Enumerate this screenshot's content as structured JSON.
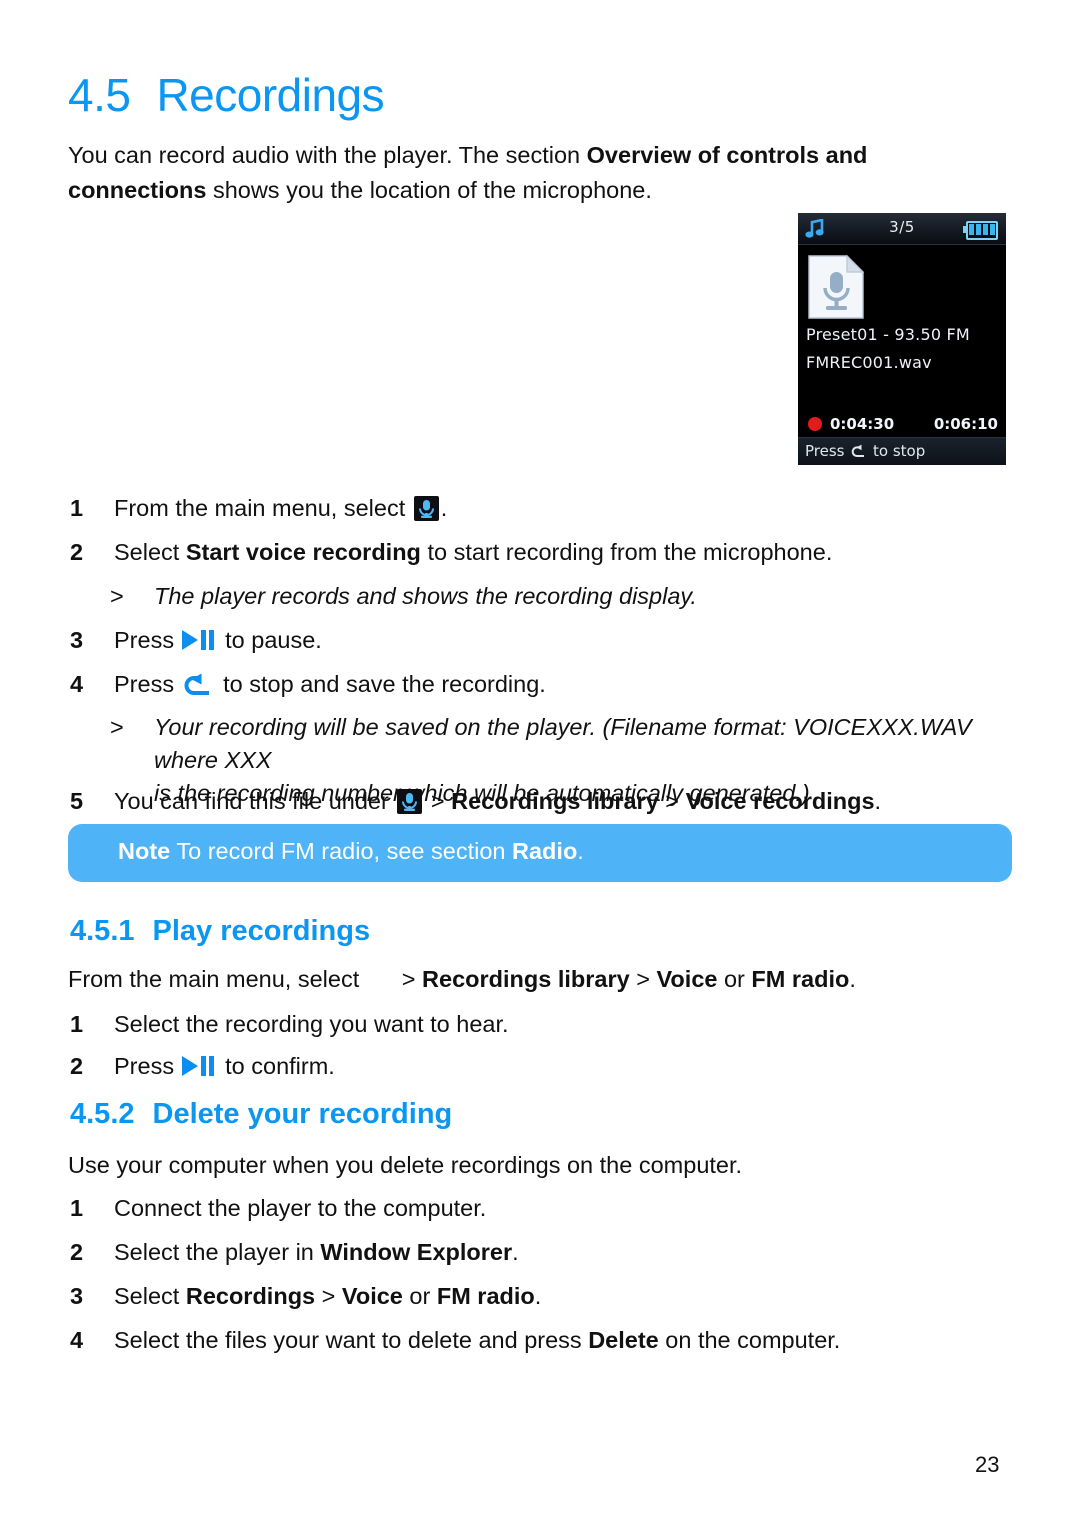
{
  "section": {
    "number": "4.5",
    "title": "Recordings"
  },
  "intro": {
    "part1": "You can record audio with the player. The section ",
    "bold1": "Overview of controls and connections",
    "part2": " shows you the location of the microphone."
  },
  "steps_main": [
    {
      "n": "1",
      "pre": "From the main menu, select ",
      "icon": "microphone-icon",
      "post": "."
    },
    {
      "n": "2",
      "pre": "Select ",
      "bold": "Start voice recording",
      "post": " to start recording from the microphone."
    },
    {
      "n": "3",
      "pre": "Press ",
      "icon": "play-pause-icon",
      "post": " to pause."
    },
    {
      "n": "4",
      "pre": "Press ",
      "icon": "back-arrow-icon",
      "post": " to stop and save the recording."
    },
    {
      "n": "5",
      "pre": "You can find this file under ",
      "icon": "microphone-icon",
      "mid": " > ",
      "bold1": "Recordings library",
      "mid2": " > ",
      "bold2": "Voice recordings",
      "post": "."
    }
  ],
  "sub_notes": [
    {
      "marker": ">",
      "text": "The player records and shows the recording display."
    },
    {
      "marker": ">",
      "line1": "Your recording will be saved on the player. (Filename format: VOICEXXX.WAV where XXX",
      "line2": "is the recording number which will be automatically generated.)"
    }
  ],
  "note_box": {
    "label": "Note",
    "text": " To record FM radio, see section ",
    "bold": "Radio",
    "period": ".",
    "background_color": "#4fb3f7"
  },
  "subsection_1": {
    "number": "4.5.1",
    "title": "Play recordings",
    "lead": {
      "pre": "From the main menu, select ",
      "gt1": "> ",
      "bold1": "Recordings library",
      "gt2": " > ",
      "bold2": "Voice",
      "mid": " or ",
      "bold3": "FM radio",
      "post": "."
    },
    "steps": [
      {
        "n": "1",
        "text": "Select the recording you want to hear."
      },
      {
        "n": "2",
        "pre": "Press ",
        "icon": "play-pause-icon",
        "post": " to confirm."
      }
    ]
  },
  "subsection_2": {
    "number": "4.5.2",
    "title": "Delete your recording",
    "lead": "Use your computer when you delete recordings on the computer.",
    "steps": [
      {
        "n": "1",
        "text": "Connect the player to the computer."
      },
      {
        "n": "2",
        "pre": "Select the player in ",
        "bold": "Window Explorer",
        "post": "."
      },
      {
        "n": "3",
        "pre": "Select ",
        "bold1": "Recordings",
        "mid1": " > ",
        "bold2": "Voice",
        "mid2": " or ",
        "bold3": "FM radio",
        "post": "."
      },
      {
        "n": "4",
        "pre": "Select the files your want to delete and press ",
        "bold": "Delete",
        "post": " on the computer."
      }
    ]
  },
  "device_screen": {
    "status_icon": "music-note-icon",
    "track_count": "3/5",
    "battery_icon": "battery-full-icon",
    "file_icon": "voice-file-icon",
    "title_line": "Preset01 - 93.50 FM",
    "filename_line": "FMREC001.wav",
    "record_indicator": "record-dot-icon",
    "elapsed_time": "0:04:30",
    "total_time": "0:06:10",
    "hint_prefix": "Press ",
    "hint_icon": "back-arrow-glyph",
    "hint_suffix": " to stop"
  },
  "footer": {
    "page_number": "23"
  },
  "colors": {
    "heading_blue": "#0b96f2",
    "note_blue": "#4fb3f7",
    "icon_blue": "#0c8ef0",
    "record_red": "#e21b1b"
  }
}
